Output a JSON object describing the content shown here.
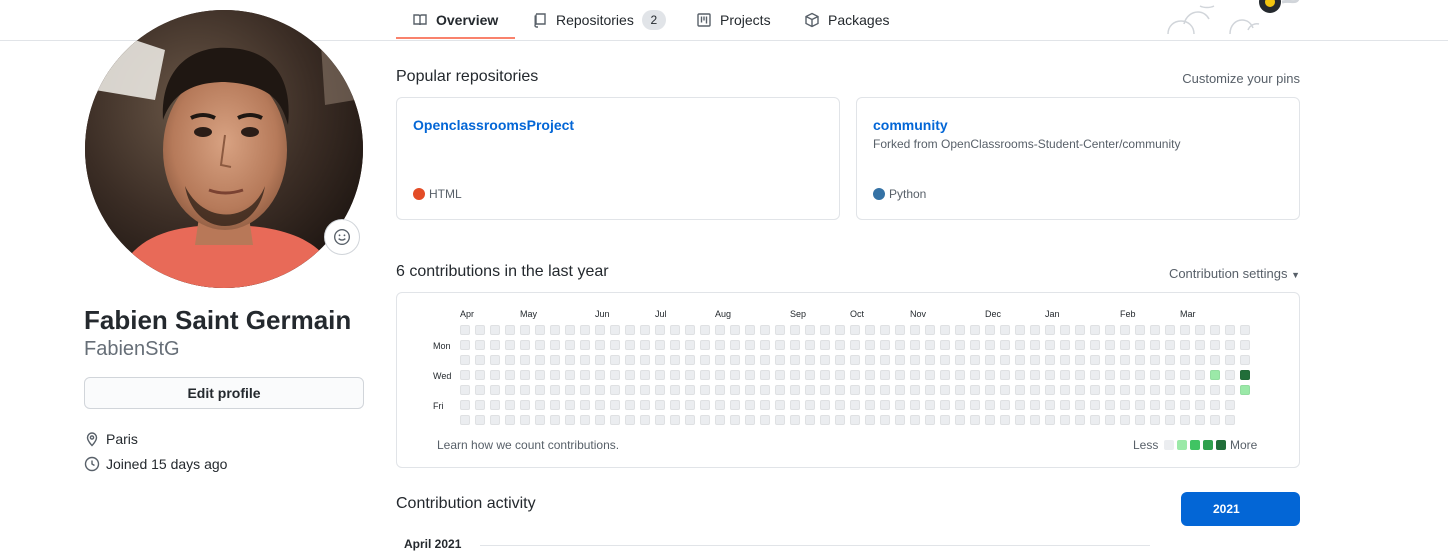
{
  "nav": {
    "tabs": [
      {
        "label": "Overview",
        "icon": "book-icon",
        "selected": true
      },
      {
        "label": "Repositories",
        "icon": "repo-icon",
        "count": "2"
      },
      {
        "label": "Projects",
        "icon": "project-icon"
      },
      {
        "label": "Packages",
        "icon": "package-icon"
      }
    ]
  },
  "profile": {
    "full_name": "Fabien Saint Germain",
    "username": "FabienStG",
    "edit_button": "Edit profile",
    "location": "Paris",
    "joined": "Joined 15 days ago",
    "status_icon": "smiley-icon"
  },
  "popular": {
    "title": "Popular repositories",
    "customize_link": "Customize your pins",
    "repos": [
      {
        "name": "OpenclassroomsProject",
        "forked_from": "",
        "language": "HTML",
        "language_color": "#e34c26"
      },
      {
        "name": "community",
        "forked_from": "Forked from OpenClassrooms-Student-Center/community",
        "language": "Python",
        "language_color": "#3572A5"
      }
    ]
  },
  "contributions": {
    "title": "6 contributions in the last year",
    "settings_link": "Contribution settings",
    "months": [
      "Apr",
      "May",
      "Jun",
      "Jul",
      "Aug",
      "Sep",
      "Oct",
      "Nov",
      "Dec",
      "Jan",
      "Feb",
      "Mar"
    ],
    "day_labels": [
      "Mon",
      "Wed",
      "Fri"
    ],
    "learn_link": "Learn how we count contributions.",
    "legend_less": "Less",
    "legend_more": "More",
    "level_colors": [
      "#ebedf0",
      "#9be9a8",
      "#40c463",
      "#30a14e",
      "#216e39"
    ],
    "highlighted_cells": [
      {
        "week": 50,
        "day": 3,
        "level": 1
      },
      {
        "week": 52,
        "day": 3,
        "level": 4
      },
      {
        "week": 52,
        "day": 4,
        "level": 1
      }
    ],
    "weeks": 53,
    "last_week_days": 5
  },
  "activity": {
    "title": "Contribution activity",
    "year_button": "2021",
    "month_heading": "April 2021"
  }
}
